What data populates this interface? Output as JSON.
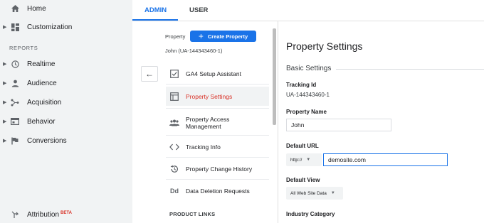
{
  "nav": {
    "home": "Home",
    "customization": "Customization",
    "reports_header": "REPORTS",
    "realtime": "Realtime",
    "audience": "Audience",
    "acquisition": "Acquisition",
    "behavior": "Behavior",
    "conversions": "Conversions",
    "attribution": "Attribution",
    "attribution_badge": "BETA"
  },
  "tabs": {
    "admin": "ADMIN",
    "user": "USER"
  },
  "property_column": {
    "property_label": "Property",
    "create_button": "Create Property",
    "account_line": "John (UA-144343460-1)",
    "items": [
      {
        "label": "GA4 Setup Assistant",
        "icon": "checkbox-icon"
      },
      {
        "label": "Property Settings",
        "icon": "settings-page-icon"
      },
      {
        "label": "Property Access Management",
        "icon": "people-icon"
      },
      {
        "label": "Tracking Info",
        "icon": "code-icon"
      },
      {
        "label": "Property Change History",
        "icon": "history-icon"
      },
      {
        "label": "Data Deletion Requests",
        "icon": "dd-icon"
      }
    ],
    "product_links_header": "PRODUCT LINKS"
  },
  "settings": {
    "title": "Property Settings",
    "basic_settings": "Basic Settings",
    "tracking_id_label": "Tracking Id",
    "tracking_id_value": "UA-144343460-1",
    "property_name_label": "Property Name",
    "property_name_value": "John",
    "default_url_label": "Default URL",
    "protocol_value": "http://",
    "default_url_value": "demosite.com",
    "default_view_label": "Default View",
    "default_view_value": "All Web Site Data",
    "industry_category_label": "Industry Category"
  },
  "colors": {
    "accent": "#1a73e8",
    "active_item": "#d93025",
    "nav_bg": "#f1f3f4"
  }
}
